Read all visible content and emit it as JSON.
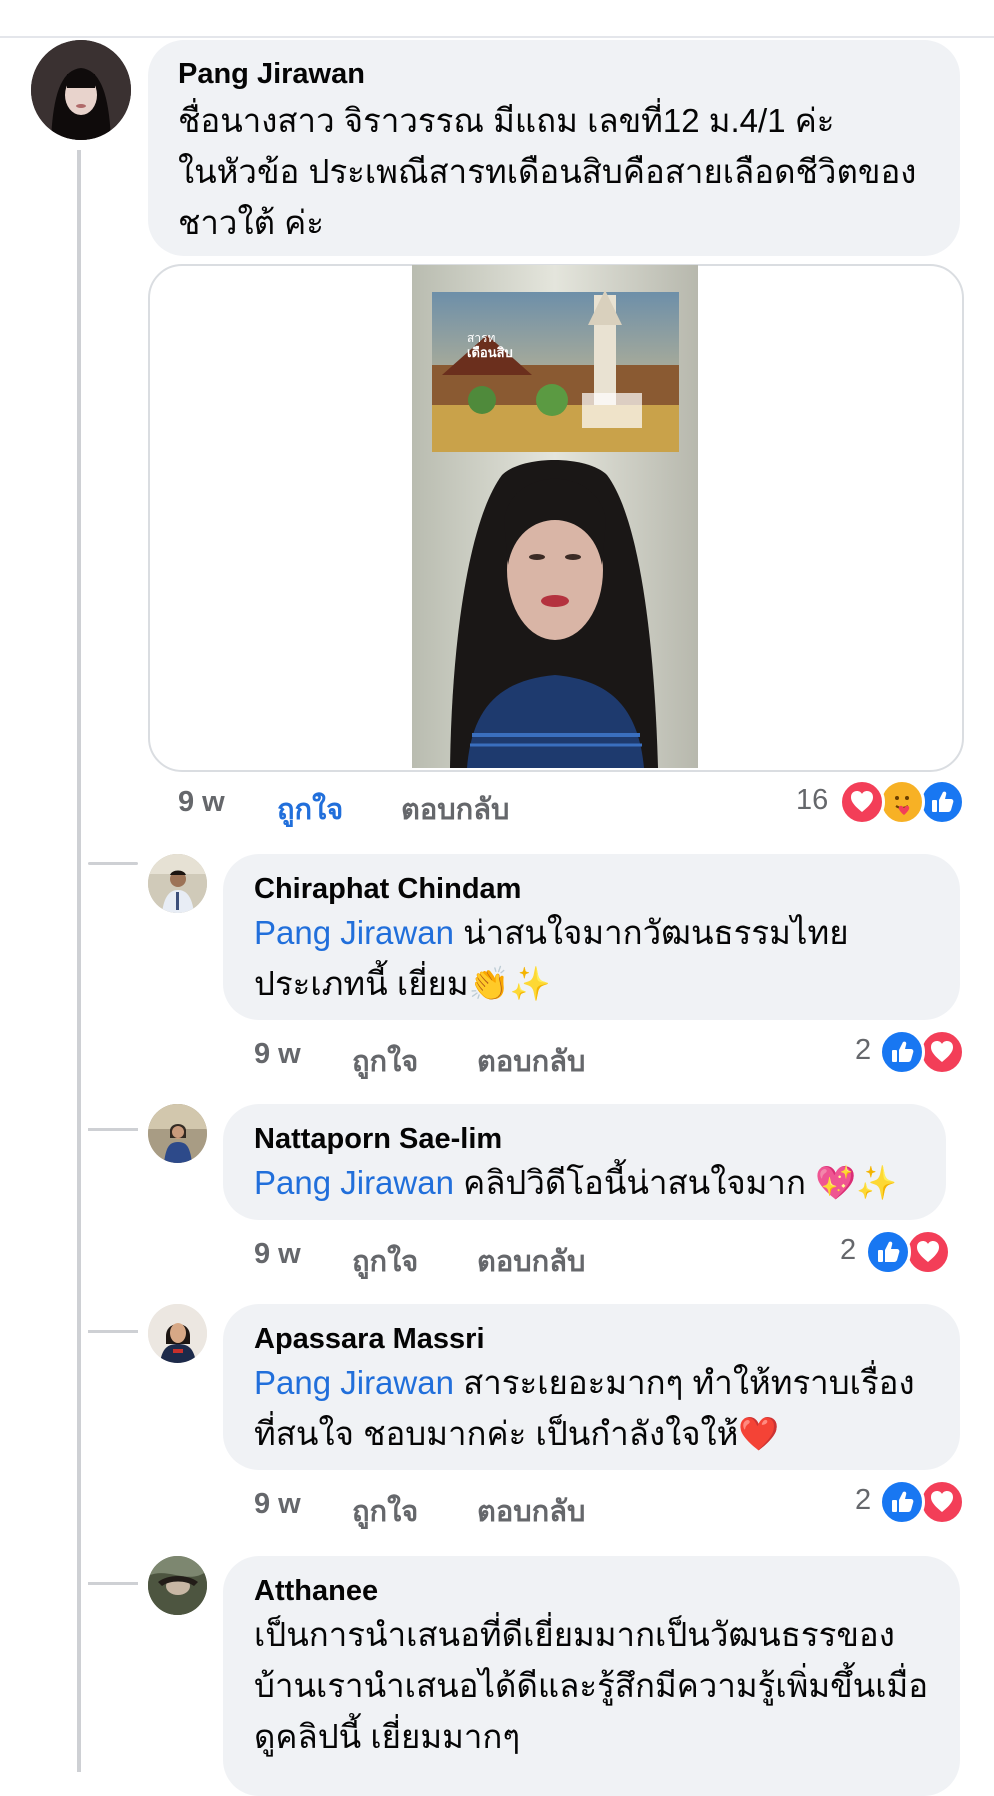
{
  "comments": [
    {
      "author": "Pang Jirawan",
      "lines": [
        "ชื่อนางสาว จิราวรรณ มีแถม เลขที่12 ม.4/1 ค่ะ",
        "ในหัวข้อ ประเพณีสารทเดือนสิบคือสายเลือดชีวิตของ",
        "ชาวใต้ ค่ะ"
      ],
      "time": "9 w",
      "like_label": "ถูกใจ",
      "reply_label": "ตอบกลับ",
      "reaction_count": "16",
      "reactions": [
        "love-icon",
        "care-icon",
        "like-icon"
      ],
      "liked_by_viewer": true
    },
    {
      "author": "Chiraphat Chindam",
      "mention": "Pang Jirawan",
      "line1_rest": " น่าสนใจมากวัฒนธรรมไทย",
      "line2": "ประเภทนี้ เยี่ยม",
      "line2_emoji": "👏✨",
      "time": "9 w",
      "like_label": "ถูกใจ",
      "reply_label": "ตอบกลับ",
      "reaction_count": "2",
      "reactions": [
        "like-icon",
        "love-icon"
      ]
    },
    {
      "author": "Nattaporn Sae-lim",
      "mention": "Pang Jirawan",
      "line1_rest": " คลิปวิดีโอนี้น่าสนใจมาก ",
      "line1_emoji": "💖✨",
      "time": "9 w",
      "like_label": "ถูกใจ",
      "reply_label": "ตอบกลับ",
      "reaction_count": "2",
      "reactions": [
        "like-icon",
        "love-icon"
      ]
    },
    {
      "author": "Apassara Massri",
      "mention": "Pang Jirawan",
      "line1_rest": " สาระเยอะมากๆ ทำให้ทราบเรื่อง",
      "line2": "ที่สนใจ ชอบมากค่ะ เป็นกำลังใจให้",
      "line2_emoji": "❤️",
      "time": "9 w",
      "like_label": "ถูกใจ",
      "reply_label": "ตอบกลับ",
      "reaction_count": "2",
      "reactions": [
        "like-icon",
        "love-icon"
      ]
    },
    {
      "author": "Atthanee",
      "lines": [
        "เป็นการนำเสนอที่ดีเยี่ยมมากเป็นวัฒนธรรของ",
        "บ้านเรานำเสนอได้ดีและรู้สึกมีความรู้เพิ่มขึ้นเมื่อ",
        "ดูคลิปนี้ เยี่ยมมากๆ"
      ]
    }
  ],
  "video": {
    "banner_text_line1": "สารท",
    "banner_text_line2": "เดือนสิบ"
  },
  "colors": {
    "mention": "#216fdb",
    "bubble": "#f0f2f5",
    "meta": "#65676b",
    "like_blue": "#1877f2",
    "love_red": "#f33e58"
  }
}
